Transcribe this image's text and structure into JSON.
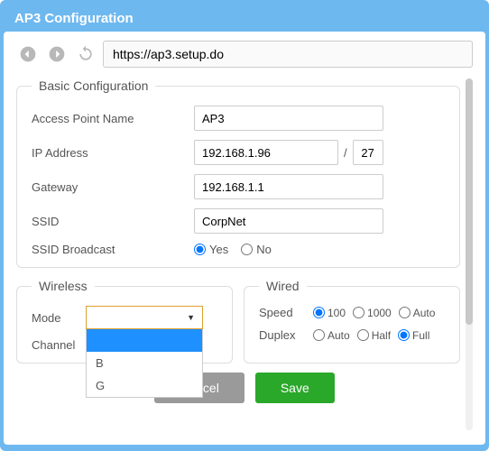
{
  "window_title": "AP3 Configuration",
  "url": "https://ap3.setup.do",
  "basic": {
    "legend": "Basic Configuration",
    "ap_name_label": "Access Point Name",
    "ap_name_value": "AP3",
    "ip_label": "IP Address",
    "ip_value": "192.168.1.96",
    "cidr_value": "27",
    "gateway_label": "Gateway",
    "gateway_value": "192.168.1.1",
    "ssid_label": "SSID",
    "ssid_value": "CorpNet",
    "broadcast_label": "SSID Broadcast",
    "yes": "Yes",
    "no": "No"
  },
  "wireless": {
    "legend": "Wireless",
    "mode_label": "Mode",
    "channel_label": "Channel",
    "options": {
      "blank": "",
      "b": "B",
      "g": "G"
    }
  },
  "wired": {
    "legend": "Wired",
    "speed_label": "Speed",
    "speed_100": "100",
    "speed_1000": "1000",
    "speed_auto": "Auto",
    "duplex_label": "Duplex",
    "duplex_auto": "Auto",
    "duplex_half": "Half",
    "duplex_full": "Full"
  },
  "buttons": {
    "cancel": "Cancel",
    "save": "Save"
  }
}
